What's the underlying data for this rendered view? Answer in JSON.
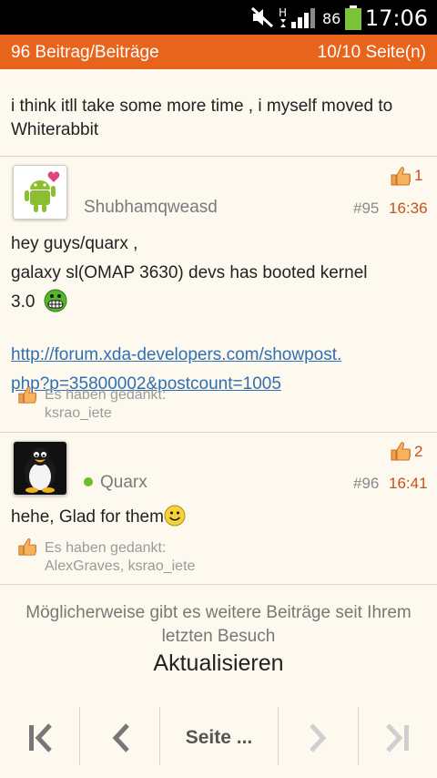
{
  "statusbar": {
    "time": "17:06",
    "battery_pct": "86"
  },
  "topbar": {
    "post_count": "96 Beitrag/Beiträge",
    "page_info": "10/10 Seite(n)"
  },
  "previous_post_text": "i think itll take some more time , i myself moved to Whiterabbit",
  "posts": [
    {
      "username": "Shubhamqweasd",
      "post_number": "#95",
      "time": "16:36",
      "likes": "1",
      "body_line1": "hey guys/quarx ,",
      "body_line2": "galaxy sl(OMAP 3630) devs has booted kernel",
      "body_line3": "3.0",
      "link": "http://forum.xda-developers.com/showpost.php?p=35800002&postcount=1005",
      "link_line1": "http://forum.xda-developers.com/showpost.",
      "link_line2": "php?p=35800002&postcount=1005",
      "thanks_label": "Es haben gedankt:",
      "thanks_users": "ksrao_iete"
    },
    {
      "username": "Quarx",
      "post_number": "#96",
      "time": "16:41",
      "likes": "2",
      "body": "hehe, Glad for them",
      "thanks_label": "Es haben gedankt:",
      "thanks_users": "AlexGraves, ksrao_iete"
    }
  ],
  "notice": "Möglicherweise gibt es weitere Beiträge seit Ihrem letzten Besuch",
  "refresh_label": "Aktualisieren",
  "nav": {
    "page_label": "Seite ..."
  },
  "colors": {
    "accent": "#e8641c",
    "link": "#2f6fb4",
    "online": "#6cbf27"
  }
}
